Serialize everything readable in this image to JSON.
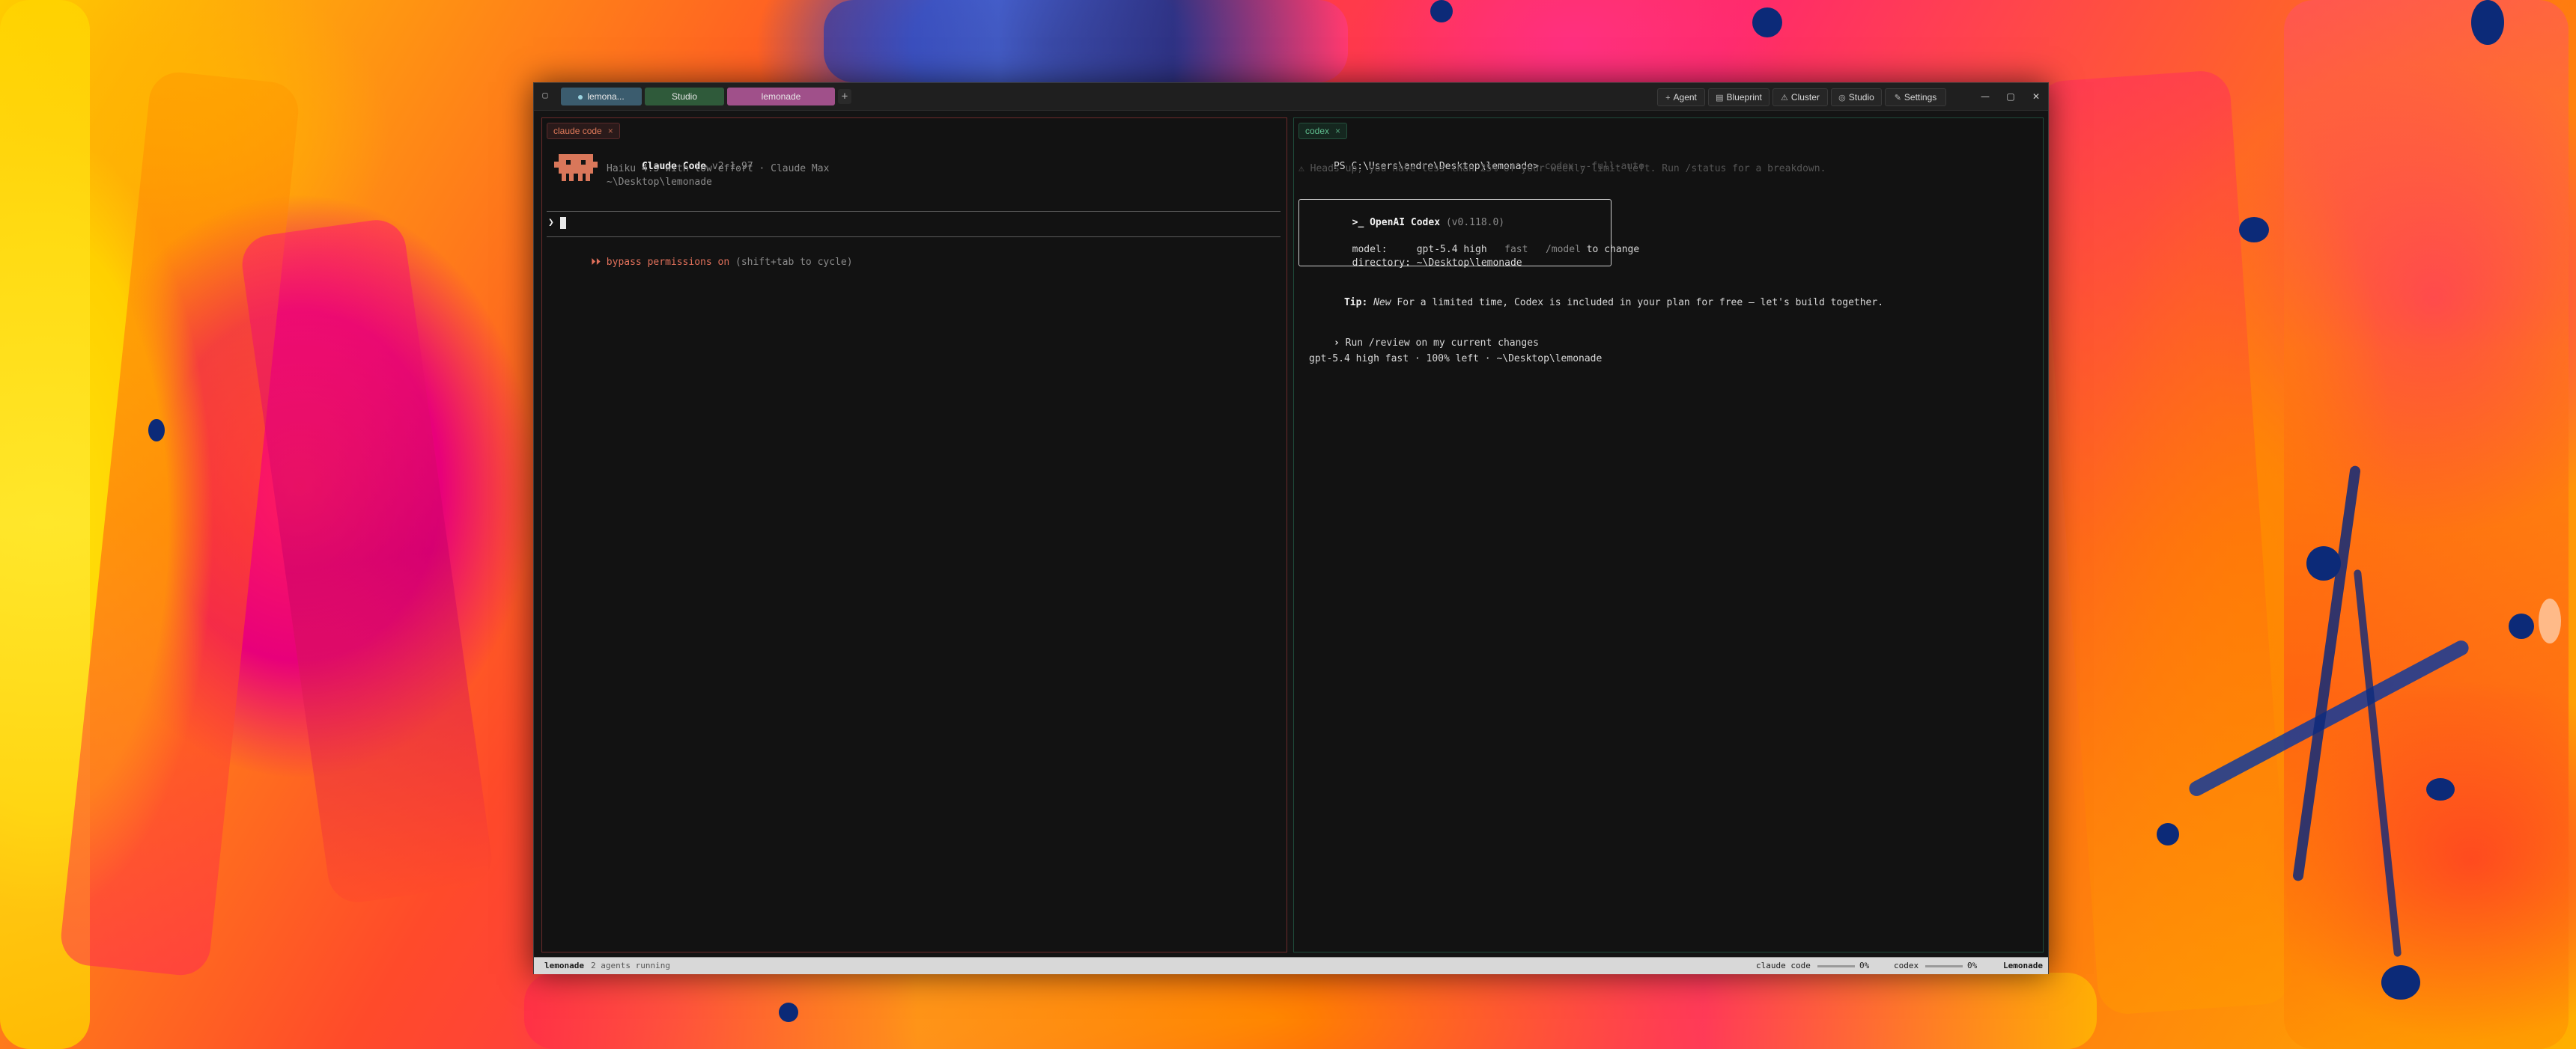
{
  "titlebar": {
    "tabs": [
      {
        "label": "lemona...",
        "color": "#3b5c6e"
      },
      {
        "label": "Studio",
        "color": "#2f5a3a"
      },
      {
        "label": "lemonade",
        "color": "#a0508a"
      }
    ],
    "add_tab_label": "+",
    "buttons": [
      {
        "label": "Agent",
        "icon": "plus-icon"
      },
      {
        "label": "Blueprint",
        "icon": "blueprint-icon"
      },
      {
        "label": "Cluster",
        "icon": "cluster-icon"
      },
      {
        "label": "Studio",
        "icon": "studio-icon"
      },
      {
        "label": "Settings",
        "icon": "wrench-icon"
      }
    ],
    "window_controls": {
      "minimize": "—",
      "maximize": "▢",
      "close": "✕"
    }
  },
  "left_pane": {
    "tab_label": "claude code",
    "tab_close": "×",
    "app_name": "Claude Code",
    "version": "v2.1.97",
    "model_line": "Haiku 4.5 with low effort · Claude Max",
    "path": "~\\Desktop\\lemonade",
    "prompt_char": "❯",
    "mode_prefix": "⏵⏵",
    "mode_text": "bypass permissions on",
    "mode_hint": "(shift+tab to cycle)",
    "accent_color": "#e0705a"
  },
  "right_pane": {
    "tab_label": "codex",
    "tab_close": "×",
    "ps_prompt": "PS C:\\Users\\andre\\Desktop\\lemonade>",
    "command": "codex",
    "command_flag": "--full-auto",
    "warning": "⚠ Heads up, you have less than 25% of your weekly limit left. Run /status for a breakdown.",
    "box": {
      "title_prefix": ">_",
      "title": "OpenAI Codex",
      "version": "(v0.118.0)",
      "model_label": "model:",
      "model_value": "gpt-5.4 high",
      "model_fast": "fast",
      "model_hint_cmd": "/model",
      "model_hint_rest": "to change",
      "directory_label": "directory:",
      "directory_value": "~\\Desktop\\lemonade"
    },
    "tip_label": "Tip:",
    "tip_new": "New",
    "tip_text": "For a limited time, Codex is included in your plan for free – let's build together.",
    "suggestion_char": "›",
    "suggestion": "Run /review on my current changes",
    "status_line": "gpt-5.4 high fast · 100% left · ~\\Desktop\\lemonade",
    "accent_color": "#5fbf8f"
  },
  "statusbar": {
    "project": "lemonade",
    "agents": "2 agents running",
    "sessions": [
      {
        "name": "claude code",
        "value": "0%"
      },
      {
        "name": "codex",
        "value": "0%"
      }
    ],
    "brand": "Lemonade"
  }
}
